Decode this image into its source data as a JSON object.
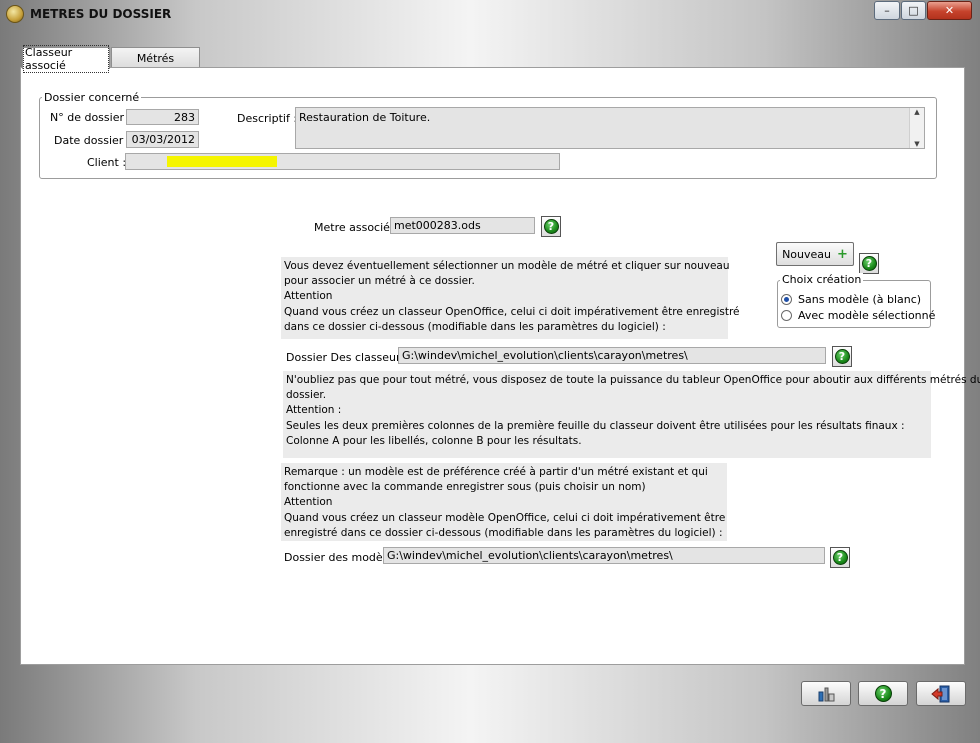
{
  "window": {
    "title": "METRES DU DOSSIER",
    "minimize": "–",
    "maximize": "□",
    "close": "✕"
  },
  "tabs": [
    {
      "label": "Classeur associé",
      "active": true
    },
    {
      "label": "Métrés",
      "active": false
    }
  ],
  "dossier": {
    "legend": "Dossier concerné",
    "numero_label": "N° de dossier :",
    "numero_value": "283",
    "date_label": "Date dossier :",
    "date_value": "03/03/2012",
    "client_label": "Client :",
    "client_value": "",
    "descriptif_label": "Descriptif :",
    "descriptif_value": "Restauration de Toiture."
  },
  "metre": {
    "label": "Metre associé",
    "value": "met000283.ods"
  },
  "nouveau": {
    "label": "Nouveau",
    "plus": "+"
  },
  "choix": {
    "legend": "Choix création",
    "options": [
      {
        "label": "Sans modèle (à blanc)",
        "selected": true
      },
      {
        "label": "Avec modèle sélectionné",
        "selected": false
      }
    ]
  },
  "info1": [
    "Vous devez éventuellement sélectionner un modèle de métré et cliquer sur nouveau",
    "pour associer un métré à ce dossier.",
    "Attention",
    "Quand vous créez un classeur OpenOffice, celui ci doit impérativement être enregistré",
    "dans ce dossier ci-dessous (modifiable dans les paramètres du logiciel) :"
  ],
  "classeurs": {
    "label": "Dossier Des classeurs",
    "value": "G:\\windev\\michel_evolution\\clients\\carayon\\metres\\"
  },
  "info2": [
    "N'oubliez pas que pour tout métré, vous disposez de toute la puissance du tableur OpenOffice pour aboutir aux différents métrés du",
    "dossier.",
    "Attention :",
    "Seules les deux premières colonnes de la première feuille du classeur doivent être utilisées pour les résultats finaux :",
    "Colonne A pour les libellés, colonne B pour les résultats."
  ],
  "info3": [
    "Remarque : un modèle est de préférence créé à partir d'un métré existant et qui",
    "fonctionne avec la commande enregistrer sous (puis choisir un nom)",
    "Attention",
    "Quand vous créez un classeur modèle OpenOffice, celui ci doit impérativement être",
    "enregistré dans ce dossier ci-dessous (modifiable dans les paramètres du logiciel) :"
  ],
  "modeles": {
    "label": "Dossier des modèles",
    "value": "G:\\windev\\michel_evolution\\clients\\carayon\\metres\\"
  },
  "help_glyph": "?",
  "bottom": {
    "tools_icon": "tools-icon",
    "help_icon": "help-icon",
    "exit_icon": "exit-icon"
  }
}
